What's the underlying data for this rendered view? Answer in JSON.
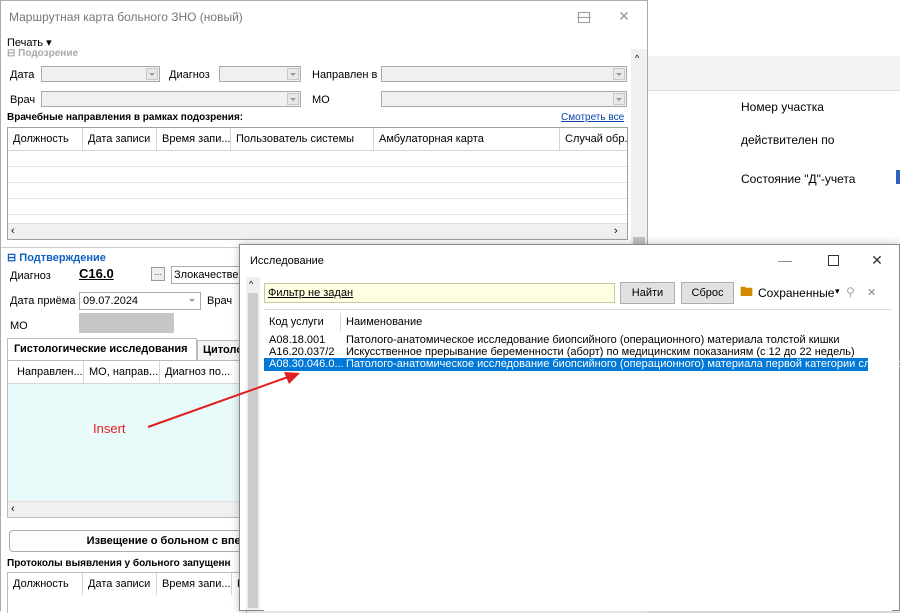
{
  "background": {
    "fields": [
      "Номер участка",
      "действителен по",
      "Состояние \"Д\"-учета"
    ]
  },
  "route_window": {
    "title": "Маршрутная карта больного ЗНО (новый)",
    "menu": {
      "print_label": "Печать ▾"
    },
    "suspicion": {
      "section_label": "Подозрение",
      "date_label": "Дата",
      "diagnosis_label": "Диагноз",
      "referred_label": "Направлен в",
      "doctor_label": "Врач",
      "mo_label": "МО",
      "referrals_title": "Врачебные направления в рамках подозрения:",
      "view_all_link": "Смотреть все",
      "columns": [
        "Должность",
        "Дата записи",
        "Время запи...",
        "Пользователь системы",
        "Амбулаторная карта",
        "Случай обр..."
      ]
    },
    "confirmation": {
      "section_label": "Подтверждение",
      "diagnosis_label": "Диагноз",
      "diagnosis_code": "C16.0",
      "diagnosis_text": "Злокачествен",
      "date_label": "Дата приёма",
      "date_value": "09.07.2024",
      "doctor_label": "Врач",
      "mo_label": "МО",
      "tabs": [
        "Гистологические исследования",
        "Цитоло"
      ],
      "columns": [
        "Направлен...",
        "МО, направ...",
        "Диагноз по..."
      ],
      "insert_annotation": "Insert",
      "notice_button": "Извещение о больном с впер",
      "protocols_title": "Протоколы выявления у больного запущенн",
      "protocol_columns": [
        "Должность",
        "Дата записи",
        "Время запи...",
        "П"
      ]
    }
  },
  "study_dialog": {
    "title": "Исследование",
    "filter_text": "Фильтр не задан",
    "find_button": "Найти",
    "reset_button": "Сброс",
    "saved_label": "Сохраненные",
    "columns": {
      "code": "Код услуги",
      "name": "Наименование"
    },
    "rows": [
      {
        "code": "A08.18.001",
        "name": "Патолого-анатомическое исследование биопсийного (операционного) материала толстой кишки",
        "selected": false
      },
      {
        "code": "A16.20.037/2",
        "name": "Искусственное прерывание беременности (аборт) по медицинским показаниям (с 12 до 22 недель)",
        "selected": false
      },
      {
        "code": "A08.30.046.0...",
        "name": "Патолого-анатомическое исследование биопсийного (операционного) материала первой категории сложности",
        "selected": true
      }
    ]
  },
  "colors": {
    "accent": "#0078d7",
    "annotation": "#e02020",
    "selection": "#0078d7"
  }
}
